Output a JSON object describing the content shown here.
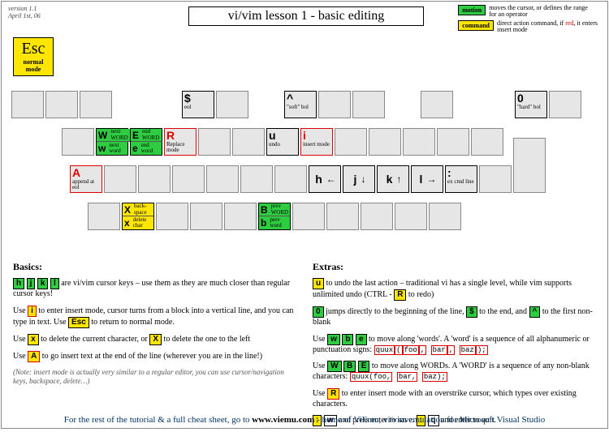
{
  "meta": {
    "version": "version 1.1",
    "date": "April 1st, 06"
  },
  "title": "vi/vim lesson 1 - basic editing",
  "legend": {
    "motion_label": "motion",
    "motion_desc": "moves the cursor, or defines the range for an operator",
    "command_label": "command",
    "command_desc_pre": "direct action command, if ",
    "command_desc_red": "red",
    "command_desc_post": ", it enters insert mode"
  },
  "esc": {
    "label": "Esc",
    "desc1": "normal",
    "desc2": "mode"
  },
  "keys": {
    "dollar": {
      "ch": "$",
      "desc": "eol"
    },
    "caret": {
      "ch": "^",
      "desc": "\"soft\" bol"
    },
    "zero": {
      "ch": "0",
      "desc": "\"hard\" bol"
    },
    "W_up": {
      "ch": "W",
      "desc": "next WORD"
    },
    "w_lo": {
      "ch": "w",
      "desc": "next word"
    },
    "E_up": {
      "ch": "E",
      "desc": "end WORD"
    },
    "e_lo": {
      "ch": "e",
      "desc": "end word"
    },
    "R_up": {
      "ch": "R",
      "desc": "Replace mode"
    },
    "u_lo": {
      "ch": "u",
      "desc": "undo"
    },
    "i_lo": {
      "ch": "i",
      "desc": "insert mode"
    },
    "A_up": {
      "ch": "A",
      "desc": "append at eol"
    },
    "h": {
      "ch": "h",
      "arrow": "←"
    },
    "j": {
      "ch": "j",
      "arrow": "↓"
    },
    "k": {
      "ch": "k",
      "arrow": "↑"
    },
    "l": {
      "ch": "l",
      "arrow": "→"
    },
    "colon": {
      "ch": ":",
      "desc": "ex cmd line"
    },
    "X_up": {
      "ch": "X",
      "desc": "back- space"
    },
    "x_lo": {
      "ch": "x",
      "desc": "delete char"
    },
    "B_up": {
      "ch": "B",
      "desc": "prev WORD"
    },
    "b_lo": {
      "ch": "b",
      "desc": "prev word"
    }
  },
  "basics": {
    "heading": "Basics:",
    "p1_mid": " are vi/vim cursor keys – use them as they are  much closer than regular cursor keys!",
    "p2_use": "Use ",
    "p2_mid": " to enter insert mode, cursor turns from a block into a vertical line, and you can type in text. Use ",
    "p2_end": "  to  return to normal mode.",
    "p3_use": "Use ",
    "p3_mid": " to delete the current character, or ",
    "p3_end": " to delete the one to the left",
    "p4_use": "Use ",
    "p4_end": " to go insert text at the end of the line (wherever you are in the line!)",
    "note": "(Note: insert mode is actually very similar to a regular editor, you can use cursor/navigation keys, backspace,  delete…)"
  },
  "extras": {
    "heading": "Extras:",
    "e1_mid": " to undo the last action – traditional vi has a single level, while vim supports unlimited undo (CTRL - ",
    "e1_end": " to redo)",
    "e2_mid": " jumps directly to the beginning of the line, ",
    "e2_mid2": " to the end, and ",
    "e2_end": " to the first non-blank",
    "e3_use": "Use ",
    "e3_mid": " to move along 'words'. A 'word' is a sequence of all alphanumeric or punctuation signs:   ",
    "e4_use": "Use ",
    "e4_mid": " to move along WORDs. A 'WORD' is a sequence of any non-blank characters:   ",
    "e5_use": "Use ",
    "e5_end": " to enter insert mode with an overstrike cursor, which types over existing characters.",
    "e6_mid": " and press enter to save. ",
    "e6_end": " and enter to quit.",
    "wordex1_a": "quux",
    "wordex1_b": "(",
    "wordex1_c": "foo",
    "wordex1_d": ",",
    "wordex1_e": "bar",
    "wordex1_f": ",",
    "wordex1_g": "baz",
    "wordex1_h": ");",
    "wordex2_a": "quux(foo,",
    "wordex2_b": "bar,",
    "wordex2_c": "baz);"
  },
  "inline": {
    "h": "h",
    "j": "j",
    "k": "k",
    "l": "l",
    "i": "i",
    "esc": "Esc",
    "x": "x",
    "X": "X",
    "A": "A",
    "u": "u",
    "R": "R",
    "zero": "0",
    "dollar": "$",
    "caret": "^",
    "w": "w",
    "b": "b",
    "e": "e",
    "W": "W",
    "B": "B",
    "E": "E",
    "colon": ":",
    "q": "q",
    "wkey": "w"
  },
  "footer": {
    "pre": "For the rest of the tutorial & a full cheat sheet, go to ",
    "url": "www.viemu.com",
    "post": " - home of ViEmu, vi/vim emulation for Microsoft Visual Studio"
  }
}
